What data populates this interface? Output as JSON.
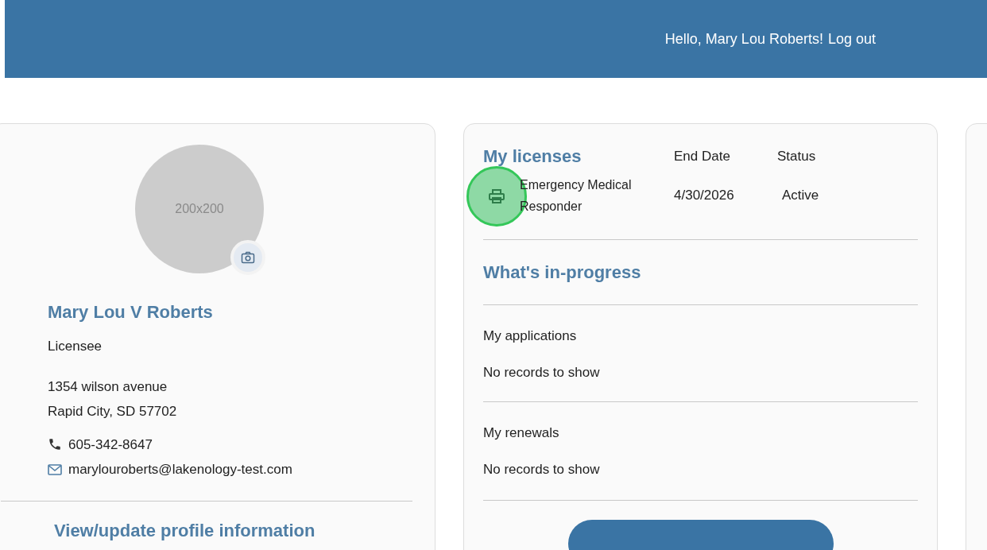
{
  "header": {
    "greeting": "Hello, Mary Lou Roberts!",
    "logout": "Log out"
  },
  "profile": {
    "avatar_placeholder": "200x200",
    "name": "Mary Lou V Roberts",
    "role": "Licensee",
    "address": [
      "1354 wilson avenue",
      "Rapid City, SD 57702"
    ],
    "phone": "605-342-8647",
    "email": "marylouroberts@lakenology-test.com",
    "link": "View/update profile information"
  },
  "licenses": {
    "title": "My licenses",
    "columns": [
      "End Date",
      "Status"
    ],
    "rows": [
      {
        "name": "Emergency Medical Responder",
        "end_date": "4/30/2026",
        "status": "Active"
      }
    ]
  },
  "in_progress": {
    "title": "What's in-progress",
    "sections": [
      {
        "title": "My applications",
        "empty": "No records to show"
      },
      {
        "title": "My renewals",
        "empty": "No records to show"
      }
    ]
  }
}
